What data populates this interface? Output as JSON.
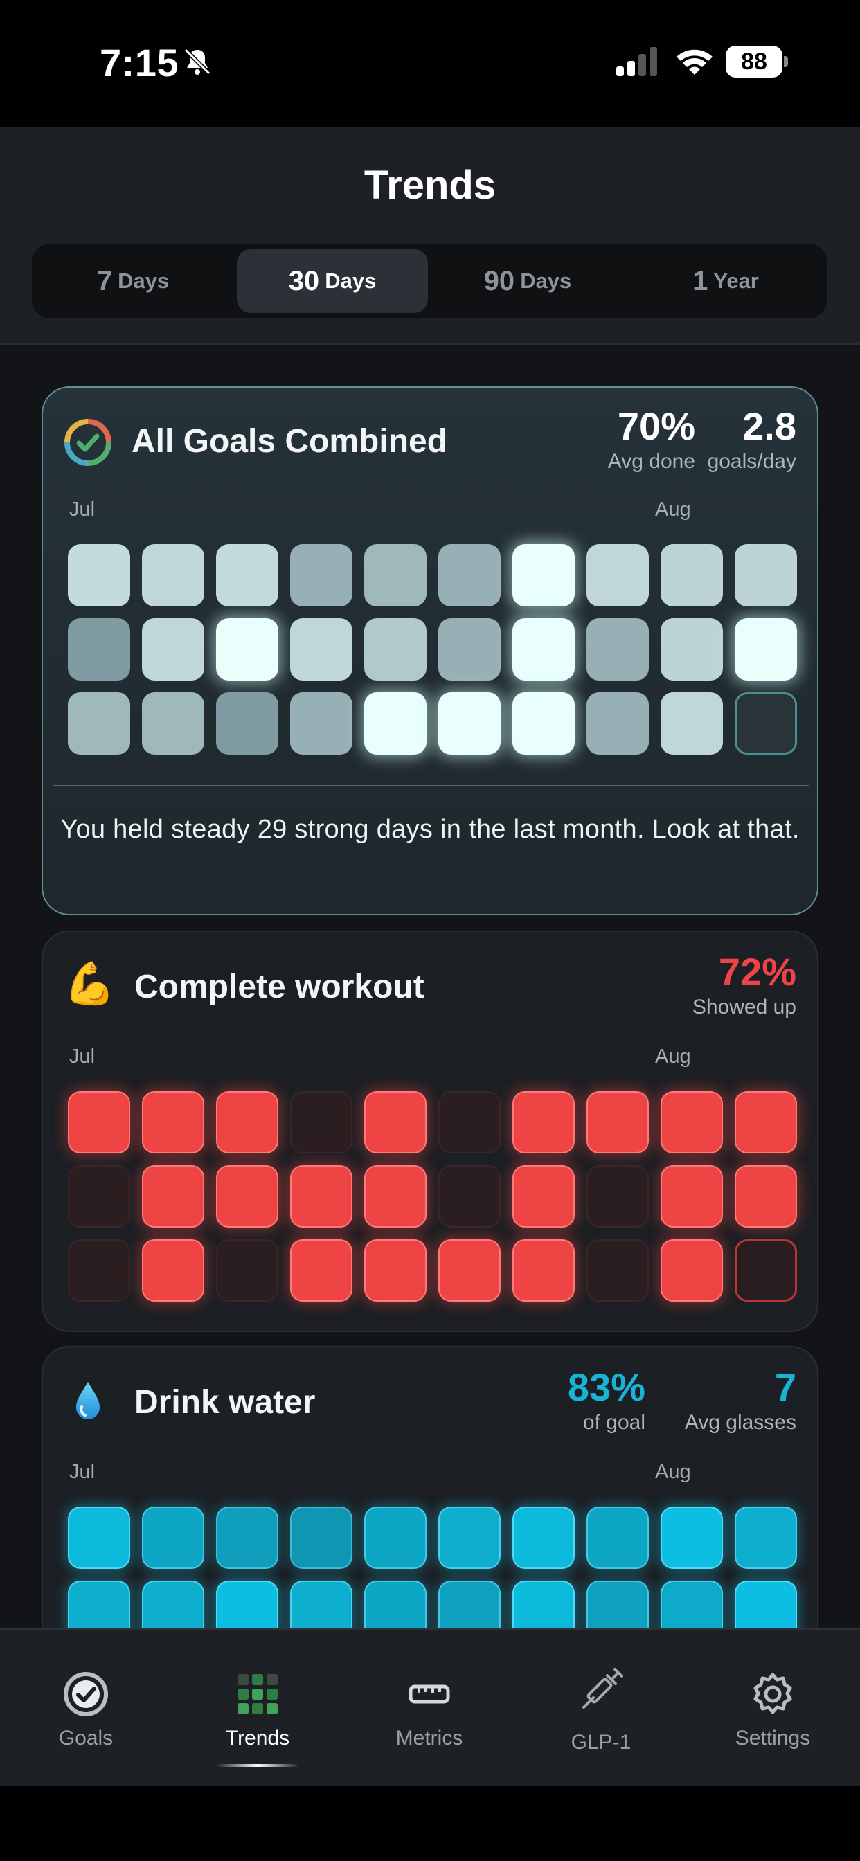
{
  "status_bar": {
    "time": "7:15",
    "battery": "88"
  },
  "header": {
    "title": "Trends",
    "ranges": [
      {
        "num": "7",
        "unit": "Days"
      },
      {
        "num": "30",
        "unit": "Days"
      },
      {
        "num": "90",
        "unit": "Days"
      },
      {
        "num": "1",
        "unit": "Year"
      }
    ],
    "selected_range": "30 Days"
  },
  "colors": {
    "combined_accent": "#5f8f92",
    "workout_red": "#ef4444",
    "water_cyan": "#0fbfdf",
    "background": "#121417"
  },
  "cards": {
    "combined": {
      "icon": "goals-ring-icon",
      "title": "All Goals Combined",
      "stat1_value": "70%",
      "stat1_label": "Avg done",
      "stat2_value": "2.8",
      "stat2_label": "goals/day",
      "month_start": "Jul",
      "month_end": "Aug",
      "levels": [
        0.75,
        0.72,
        0.74,
        0.45,
        0.5,
        0.45,
        1.0,
        0.72,
        0.7,
        0.7,
        0.3,
        0.72,
        1.0,
        0.72,
        0.62,
        0.45,
        1.0,
        0.45,
        0.7,
        1.0,
        0.5,
        0.5,
        0.3,
        0.45,
        1.0,
        1.0,
        1.0,
        0.45,
        0.72,
        0.0
      ],
      "message": "You held steady 29 strong days in the last month. Look at that."
    },
    "workout": {
      "icon": "flexed-biceps-icon",
      "title": "Complete workout",
      "stat1_value": "72%",
      "stat1_label": "Showed up",
      "month_start": "Jul",
      "month_end": "Aug",
      "done": [
        1,
        1,
        1,
        0,
        1,
        0,
        1,
        1,
        1,
        1,
        0,
        1,
        1,
        1,
        1,
        0,
        1,
        0,
        1,
        1,
        0,
        1,
        0,
        1,
        1,
        1,
        1,
        0,
        1,
        0
      ]
    },
    "water": {
      "icon": "water-drop-icon",
      "title": "Drink water",
      "stat1_value": "83%",
      "stat1_label": "of goal",
      "stat2_value": "7",
      "stat2_label": "Avg glasses",
      "month_start": "Jul",
      "month_end": "Aug",
      "levels": [
        0.95,
        0.7,
        0.6,
        0.5,
        0.7,
        0.8,
        0.95,
        0.7,
        1.0,
        0.8,
        0.8,
        0.8,
        1.0,
        0.8,
        0.7,
        0.65,
        0.95,
        0.65,
        0.75,
        1.0
      ]
    }
  },
  "tabs": [
    {
      "label": "Goals",
      "icon": "goals-check-icon"
    },
    {
      "label": "Trends",
      "icon": "trends-grid-icon"
    },
    {
      "label": "Metrics",
      "icon": "ruler-icon"
    },
    {
      "label": "GLP-1",
      "icon": "syringe-icon"
    },
    {
      "label": "Settings",
      "icon": "gear-icon"
    }
  ],
  "active_tab": "Trends"
}
